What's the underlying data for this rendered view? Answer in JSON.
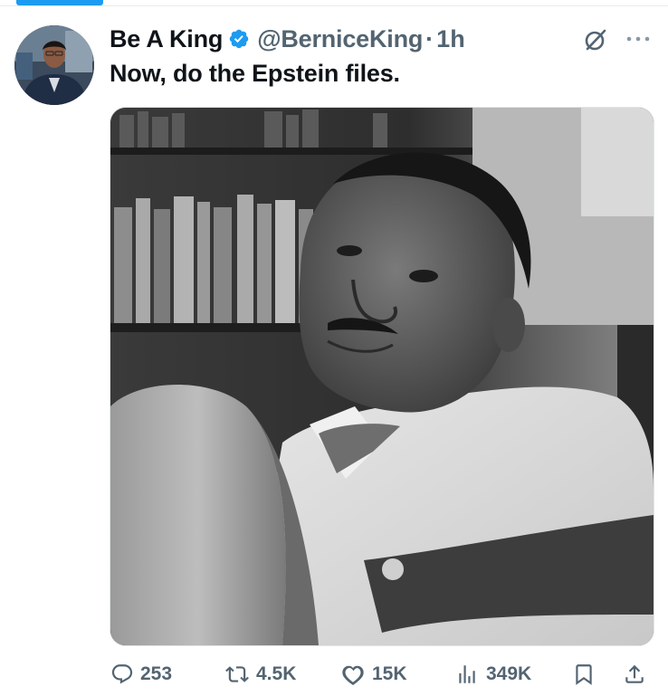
{
  "tweet": {
    "display_name": "Be A King",
    "handle": "@BerniceKing",
    "separator": "·",
    "time": "1h",
    "text": "Now, do the Epstein files."
  },
  "metrics": {
    "replies": "253",
    "reposts": "4.5K",
    "likes": "15K",
    "views": "349K"
  },
  "colors": {
    "accent": "#1d9bf0",
    "text_primary": "#0f1419",
    "text_secondary": "#536471"
  },
  "icons": {
    "verified": "verified-badge-icon",
    "grok": "grok-icon",
    "more": "more-icon",
    "reply": "reply-icon",
    "repost": "repost-icon",
    "like": "like-icon",
    "views": "views-icon",
    "bookmark": "bookmark-icon",
    "share": "share-icon"
  }
}
